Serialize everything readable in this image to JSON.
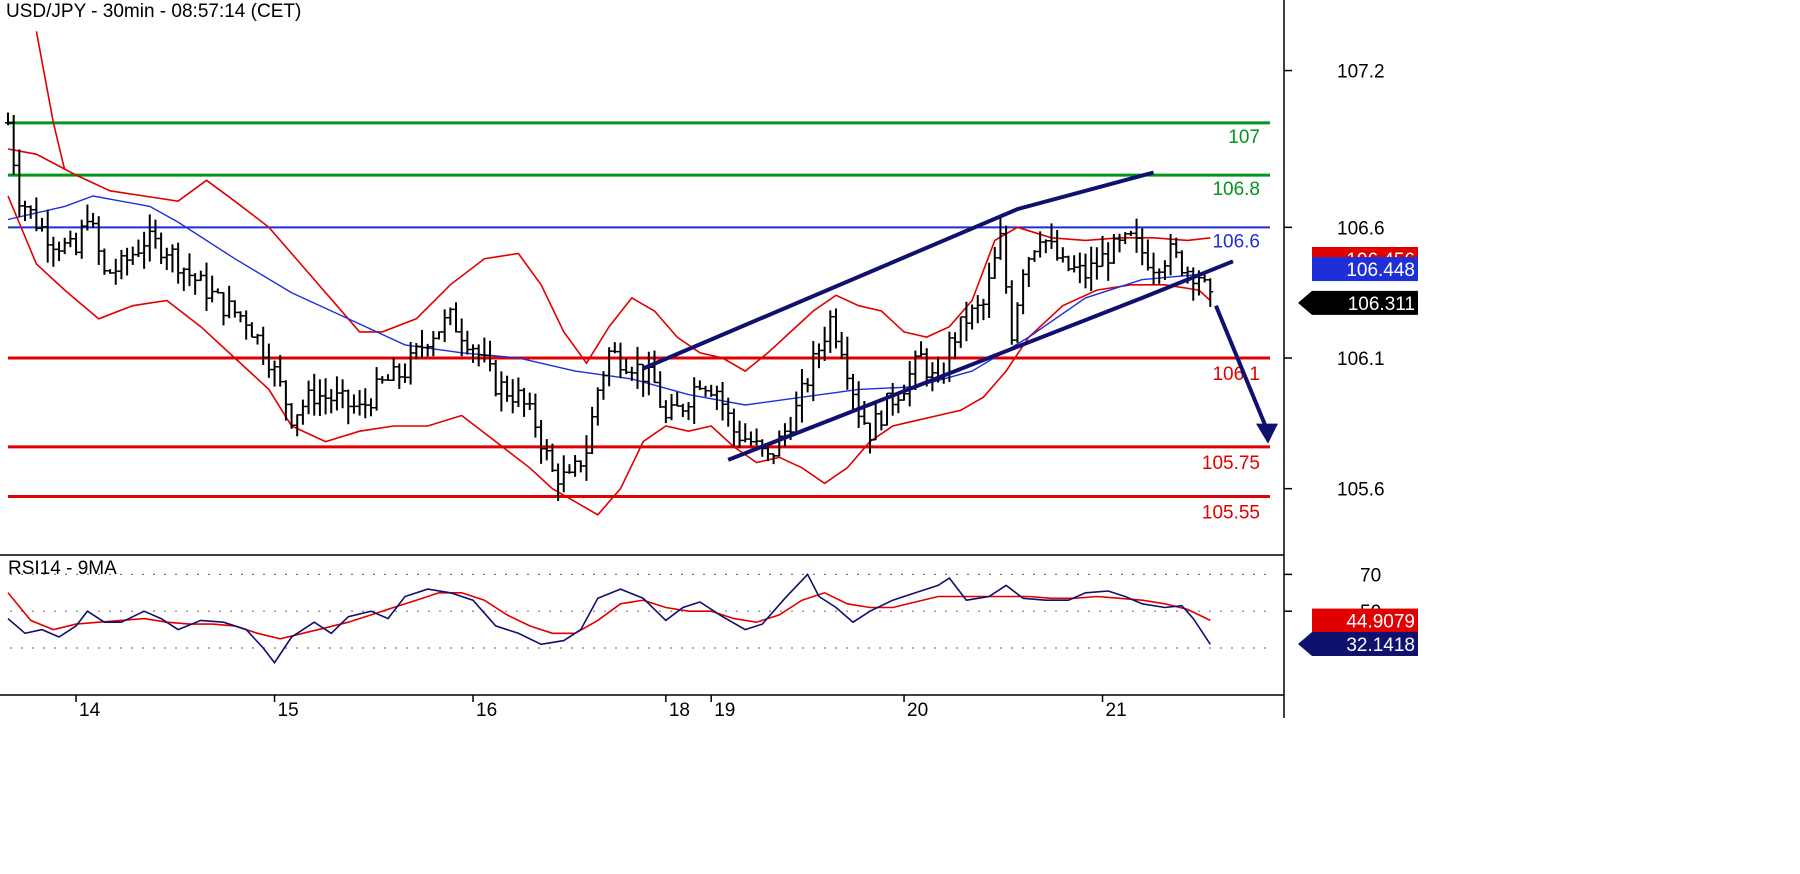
{
  "title": "USD/JPY - 30min - 08:57:14 (CET)",
  "rsi_title": "RSI14 - 9MA",
  "colors": {
    "green": "#00961e",
    "red": "#e00000",
    "blue": "#1f2fd8",
    "navy": "#10106e",
    "black": "#000000",
    "grid": "#7a7a7a"
  },
  "chart_data": [
    {
      "type": "line",
      "name": "price",
      "y_ticks": [
        "107.2",
        "106.6",
        "106.1",
        "105.6"
      ],
      "y_tick_values": [
        107.2,
        106.6,
        106.1,
        105.6
      ],
      "ylim": [
        105.35,
        107.47
      ],
      "x_labels": [
        {
          "label": "14",
          "bar": 12
        },
        {
          "label": "15",
          "bar": 47
        },
        {
          "label": "16",
          "bar": 82
        },
        {
          "label": "18",
          "bar": 116
        },
        {
          "label": "19",
          "bar": 124
        },
        {
          "label": "20",
          "bar": 158
        },
        {
          "label": "21",
          "bar": 193
        }
      ],
      "total_bars": 225,
      "levels": [
        {
          "label": "107",
          "value": 107.0,
          "color": "green"
        },
        {
          "label": "106.8",
          "value": 106.8,
          "color": "green"
        },
        {
          "label": "106.6",
          "value": 106.6,
          "color": "blue"
        },
        {
          "label": "106.1",
          "value": 106.1,
          "color": "red"
        },
        {
          "label": "105.75",
          "value": 105.76,
          "color": "red"
        },
        {
          "label": "105.55",
          "value": 105.57,
          "color": "red"
        }
      ],
      "value_tags": [
        {
          "label": "106.456",
          "value": 106.456,
          "color": "red"
        },
        {
          "label": "106.448",
          "value": 106.448,
          "color": "blue"
        },
        {
          "label": "106.311",
          "value": 106.311,
          "color": "black"
        }
      ],
      "close_path": [
        [
          0,
          107.0
        ],
        [
          2,
          106.72
        ],
        [
          5,
          106.62
        ],
        [
          8,
          106.55
        ],
        [
          12,
          106.5
        ],
        [
          14,
          106.66
        ],
        [
          17,
          106.42
        ],
        [
          20,
          106.45
        ],
        [
          24,
          106.55
        ],
        [
          28,
          106.52
        ],
        [
          32,
          106.42
        ],
        [
          35,
          106.36
        ],
        [
          38,
          106.3
        ],
        [
          42,
          106.25
        ],
        [
          46,
          106.1
        ],
        [
          50,
          105.88
        ],
        [
          54,
          105.96
        ],
        [
          58,
          105.94
        ],
        [
          62,
          105.9
        ],
        [
          66,
          106.0
        ],
        [
          70,
          106.05
        ],
        [
          74,
          106.18
        ],
        [
          78,
          106.25
        ],
        [
          82,
          106.15
        ],
        [
          86,
          106.0
        ],
        [
          90,
          105.95
        ],
        [
          93,
          105.85
        ],
        [
          96,
          105.66
        ],
        [
          99,
          105.63
        ],
        [
          102,
          105.75
        ],
        [
          104,
          105.98
        ],
        [
          106,
          106.12
        ],
        [
          110,
          106.08
        ],
        [
          114,
          106.0
        ],
        [
          116,
          105.86
        ],
        [
          119,
          105.92
        ],
        [
          122,
          106.02
        ],
        [
          125,
          105.98
        ],
        [
          128,
          105.82
        ],
        [
          131,
          105.78
        ],
        [
          134,
          105.71
        ],
        [
          136,
          105.78
        ],
        [
          139,
          105.9
        ],
        [
          142,
          106.08
        ],
        [
          145,
          106.25
        ],
        [
          147,
          106.15
        ],
        [
          150,
          105.9
        ],
        [
          152,
          105.82
        ],
        [
          155,
          105.92
        ],
        [
          158,
          106.0
        ],
        [
          161,
          106.1
        ],
        [
          164,
          105.98
        ],
        [
          166,
          106.15
        ],
        [
          169,
          106.25
        ],
        [
          172,
          106.3
        ],
        [
          175,
          106.55
        ],
        [
          177,
          106.2
        ],
        [
          179,
          106.45
        ],
        [
          182,
          106.58
        ],
        [
          186,
          106.45
        ],
        [
          190,
          106.42
        ],
        [
          194,
          106.5
        ],
        [
          198,
          106.55
        ],
        [
          202,
          106.46
        ],
        [
          205,
          106.5
        ],
        [
          208,
          106.44
        ],
        [
          210,
          106.42
        ],
        [
          212,
          106.311
        ]
      ],
      "moving_average": [
        [
          0,
          106.63
        ],
        [
          10,
          106.68
        ],
        [
          15,
          106.72
        ],
        [
          25,
          106.68
        ],
        [
          30,
          106.62
        ],
        [
          40,
          106.48
        ],
        [
          50,
          106.35
        ],
        [
          60,
          106.25
        ],
        [
          70,
          106.15
        ],
        [
          80,
          106.12
        ],
        [
          90,
          106.1
        ],
        [
          100,
          106.05
        ],
        [
          110,
          106.02
        ],
        [
          120,
          105.96
        ],
        [
          130,
          105.92
        ],
        [
          140,
          105.95
        ],
        [
          150,
          105.98
        ],
        [
          160,
          105.99
        ],
        [
          170,
          106.05
        ],
        [
          180,
          106.18
        ],
        [
          190,
          106.33
        ],
        [
          200,
          106.4
        ],
        [
          210,
          106.42
        ]
      ],
      "bollinger_upper": [
        [
          0,
          106.9
        ],
        [
          5,
          106.88
        ],
        [
          12,
          106.8
        ],
        [
          18,
          106.74
        ],
        [
          24,
          106.72
        ],
        [
          30,
          106.7
        ],
        [
          35,
          106.78
        ],
        [
          40,
          106.7
        ],
        [
          46,
          106.6
        ],
        [
          52,
          106.45
        ],
        [
          58,
          106.3
        ],
        [
          62,
          106.2
        ],
        [
          66,
          106.2
        ],
        [
          72,
          106.25
        ],
        [
          78,
          106.38
        ],
        [
          84,
          106.48
        ],
        [
          90,
          106.5
        ],
        [
          94,
          106.38
        ],
        [
          98,
          106.2
        ],
        [
          102,
          106.08
        ],
        [
          106,
          106.22
        ],
        [
          110,
          106.33
        ],
        [
          114,
          106.28
        ],
        [
          118,
          106.18
        ],
        [
          122,
          106.12
        ],
        [
          126,
          106.1
        ],
        [
          130,
          106.05
        ],
        [
          134,
          106.12
        ],
        [
          138,
          106.2
        ],
        [
          142,
          106.28
        ],
        [
          146,
          106.34
        ],
        [
          150,
          106.3
        ],
        [
          154,
          106.28
        ],
        [
          158,
          106.2
        ],
        [
          162,
          106.18
        ],
        [
          166,
          106.22
        ],
        [
          170,
          106.32
        ],
        [
          174,
          106.55
        ],
        [
          178,
          106.6
        ],
        [
          184,
          106.56
        ],
        [
          190,
          106.55
        ],
        [
          196,
          106.56
        ],
        [
          202,
          106.56
        ],
        [
          208,
          106.55
        ],
        [
          212,
          106.56
        ]
      ],
      "bollinger_lower": [
        [
          0,
          106.72
        ],
        [
          5,
          106.46
        ],
        [
          10,
          106.36
        ],
        [
          16,
          106.25
        ],
        [
          22,
          106.3
        ],
        [
          28,
          106.32
        ],
        [
          34,
          106.22
        ],
        [
          40,
          106.1
        ],
        [
          46,
          105.98
        ],
        [
          50,
          105.84
        ],
        [
          56,
          105.78
        ],
        [
          62,
          105.82
        ],
        [
          68,
          105.84
        ],
        [
          74,
          105.84
        ],
        [
          80,
          105.88
        ],
        [
          86,
          105.78
        ],
        [
          92,
          105.68
        ],
        [
          96,
          105.6
        ],
        [
          100,
          105.55
        ],
        [
          104,
          105.5
        ],
        [
          108,
          105.6
        ],
        [
          112,
          105.78
        ],
        [
          116,
          105.84
        ],
        [
          120,
          105.82
        ],
        [
          124,
          105.84
        ],
        [
          128,
          105.76
        ],
        [
          132,
          105.7
        ],
        [
          136,
          105.72
        ],
        [
          140,
          105.68
        ],
        [
          144,
          105.62
        ],
        [
          148,
          105.68
        ],
        [
          152,
          105.78
        ],
        [
          156,
          105.84
        ],
        [
          160,
          105.86
        ],
        [
          164,
          105.88
        ],
        [
          168,
          105.9
        ],
        [
          172,
          105.95
        ],
        [
          176,
          106.05
        ],
        [
          180,
          106.18
        ],
        [
          186,
          106.3
        ],
        [
          192,
          106.36
        ],
        [
          198,
          106.38
        ],
        [
          204,
          106.38
        ],
        [
          210,
          106.36
        ],
        [
          212,
          106.32
        ]
      ],
      "channel_upper": [
        [
          112,
          106.06
        ],
        [
          178,
          106.67
        ],
        [
          202,
          106.81
        ]
      ],
      "channel_lower": [
        [
          127,
          105.71
        ],
        [
          200,
          106.33
        ],
        [
          216,
          106.47
        ]
      ],
      "forecast_arrow": [
        [
          213,
          106.3
        ],
        [
          222,
          105.78
        ]
      ]
    },
    {
      "type": "line",
      "name": "rsi",
      "y_ticks": [
        "70",
        "50"
      ],
      "y_tick_values": [
        70,
        50
      ],
      "ylim": [
        5,
        80
      ],
      "grid_levels": [
        70,
        50,
        30
      ],
      "value_tags": [
        {
          "label": "44.9079",
          "value": 44.9079,
          "color": "red"
        },
        {
          "label": "32.1418",
          "value": 32.1418,
          "color": "navy"
        }
      ],
      "rsi": [
        [
          0,
          46
        ],
        [
          3,
          38
        ],
        [
          6,
          40
        ],
        [
          9,
          36
        ],
        [
          12,
          42
        ],
        [
          14,
          50
        ],
        [
          17,
          44
        ],
        [
          20,
          44
        ],
        [
          24,
          50
        ],
        [
          27,
          46
        ],
        [
          30,
          40
        ],
        [
          34,
          45
        ],
        [
          38,
          44
        ],
        [
          42,
          40
        ],
        [
          45,
          30
        ],
        [
          47,
          22
        ],
        [
          50,
          36
        ],
        [
          54,
          44
        ],
        [
          57,
          38
        ],
        [
          60,
          47
        ],
        [
          64,
          50
        ],
        [
          67,
          46
        ],
        [
          70,
          58
        ],
        [
          74,
          62
        ],
        [
          78,
          60
        ],
        [
          82,
          56
        ],
        [
          86,
          42
        ],
        [
          90,
          38
        ],
        [
          94,
          32
        ],
        [
          98,
          34
        ],
        [
          101,
          40
        ],
        [
          104,
          57
        ],
        [
          108,
          62
        ],
        [
          112,
          57
        ],
        [
          116,
          45
        ],
        [
          119,
          52
        ],
        [
          122,
          55
        ],
        [
          126,
          47
        ],
        [
          130,
          40
        ],
        [
          133,
          43
        ],
        [
          137,
          57
        ],
        [
          141,
          70
        ],
        [
          143,
          58
        ],
        [
          146,
          52
        ],
        [
          149,
          44
        ],
        [
          152,
          50
        ],
        [
          156,
          56
        ],
        [
          160,
          60
        ],
        [
          164,
          64
        ],
        [
          166,
          68
        ],
        [
          169,
          56
        ],
        [
          173,
          58
        ],
        [
          176,
          64
        ],
        [
          179,
          57
        ],
        [
          183,
          56
        ],
        [
          187,
          56
        ],
        [
          190,
          60
        ],
        [
          194,
          61
        ],
        [
          197,
          58
        ],
        [
          200,
          54
        ],
        [
          204,
          52
        ],
        [
          207,
          53
        ],
        [
          209,
          46
        ],
        [
          212,
          32
        ]
      ],
      "rsi_ma": [
        [
          0,
          60
        ],
        [
          4,
          45
        ],
        [
          8,
          40
        ],
        [
          12,
          43
        ],
        [
          16,
          44
        ],
        [
          20,
          45
        ],
        [
          24,
          46
        ],
        [
          28,
          44
        ],
        [
          32,
          43
        ],
        [
          36,
          43
        ],
        [
          40,
          42
        ],
        [
          44,
          38
        ],
        [
          48,
          35
        ],
        [
          52,
          38
        ],
        [
          56,
          41
        ],
        [
          60,
          44
        ],
        [
          64,
          48
        ],
        [
          68,
          52
        ],
        [
          72,
          56
        ],
        [
          76,
          60
        ],
        [
          80,
          60
        ],
        [
          84,
          56
        ],
        [
          88,
          48
        ],
        [
          92,
          42
        ],
        [
          96,
          38
        ],
        [
          100,
          38
        ],
        [
          104,
          45
        ],
        [
          108,
          54
        ],
        [
          112,
          56
        ],
        [
          116,
          52
        ],
        [
          120,
          50
        ],
        [
          124,
          50
        ],
        [
          128,
          46
        ],
        [
          132,
          44
        ],
        [
          136,
          48
        ],
        [
          140,
          56
        ],
        [
          144,
          60
        ],
        [
          148,
          54
        ],
        [
          152,
          52
        ],
        [
          156,
          52
        ],
        [
          160,
          55
        ],
        [
          164,
          58
        ],
        [
          168,
          58
        ],
        [
          172,
          58
        ],
        [
          176,
          58
        ],
        [
          180,
          58
        ],
        [
          184,
          57
        ],
        [
          188,
          57
        ],
        [
          192,
          58
        ],
        [
          196,
          57
        ],
        [
          200,
          56
        ],
        [
          204,
          54
        ],
        [
          208,
          51
        ],
        [
          212,
          45
        ]
      ]
    }
  ]
}
